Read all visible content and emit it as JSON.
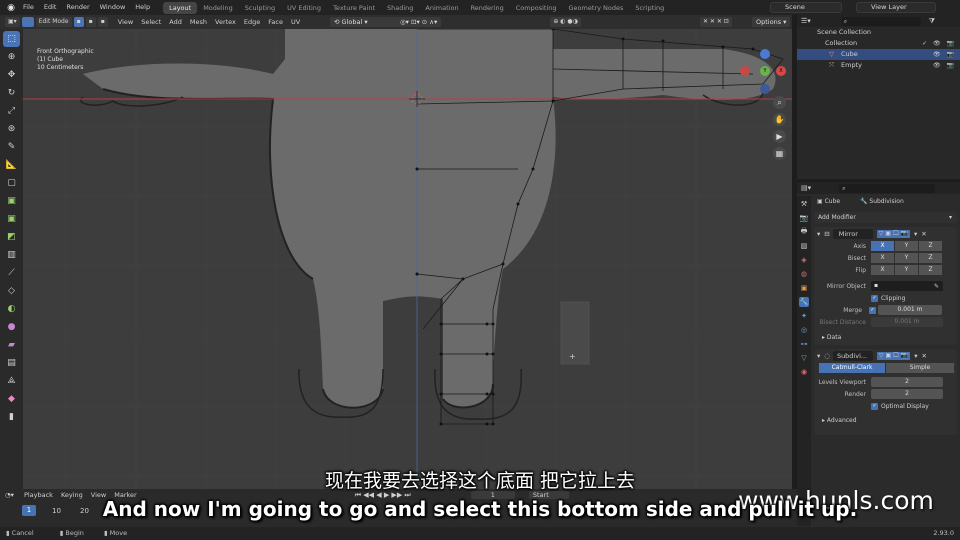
{
  "menu": [
    "File",
    "Edit",
    "Render",
    "Window",
    "Help"
  ],
  "workspaces": [
    "Layout",
    "Modeling",
    "Sculpting",
    "UV Editing",
    "Texture Paint",
    "Shading",
    "Animation",
    "Rendering",
    "Compositing",
    "Geometry Nodes",
    "Scripting"
  ],
  "active_workspace": "Layout",
  "scene": "Scene",
  "view_layer": "View Layer",
  "header": {
    "mode": "Edit Mode",
    "menus": [
      "View",
      "Select",
      "Add",
      "Mesh",
      "Vertex",
      "Edge",
      "Face",
      "UV"
    ],
    "orientation": "Global",
    "options": "Options"
  },
  "viewport_info": {
    "line1": "Front Orthographic",
    "line2": "(1) Cube",
    "line3": "10 Centimeters"
  },
  "outliner": {
    "root": "Scene Collection",
    "collection": "Collection",
    "items": [
      "Cube",
      "Empty"
    ]
  },
  "properties": {
    "object": "Cube",
    "modifier_tab": "Subdivision",
    "add_modifier": "Add Modifier",
    "mirror": {
      "name": "Mirror",
      "axis_label": "Axis",
      "bisect_label": "Bisect",
      "flip_label": "Flip",
      "axes": [
        "X",
        "Y",
        "Z"
      ],
      "mirror_object_label": "Mirror Object",
      "clipping_label": "Clipping",
      "merge_label": "Merge",
      "merge_value": "0.001 m",
      "bisect_distance_label": "Bisect Distance",
      "bisect_distance_value": "0.001 m",
      "data_label": "Data"
    },
    "subdivision": {
      "name": "Subdivi...",
      "method_a": "Catmull-Clark",
      "method_b": "Simple",
      "levels_viewport_label": "Levels Viewport",
      "levels_viewport": "2",
      "render_label": "Render",
      "render": "2",
      "optimal_label": "Optimal Display",
      "advanced_label": "Advanced"
    }
  },
  "timeline": {
    "menus": [
      "Playback",
      "Keying",
      "View",
      "Marker"
    ],
    "current_frame": "1",
    "frame_field": "1",
    "start_label": "Start",
    "start_value": "1",
    "ticks": [
      "1",
      "10",
      "20"
    ]
  },
  "status": {
    "left1": "Cancel",
    "left2": "Begin",
    "left3": "Move",
    "version": "2.93.0"
  },
  "subtitle_cn": "现在我要去选择这个底面 把它拉上去",
  "subtitle_en": "And now I'm going to go and select this bottom side and pull it up.",
  "watermark": "www.hunls.com"
}
